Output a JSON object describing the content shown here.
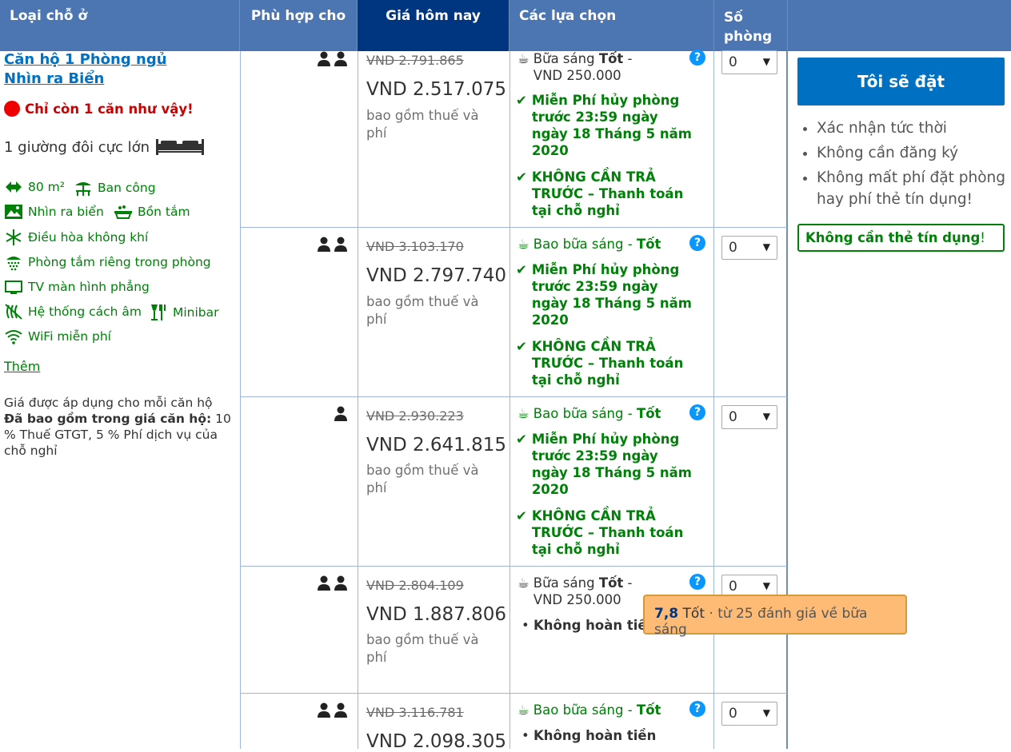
{
  "headers": {
    "room_type": "Loại chỗ ở",
    "sleeps": "Phù hợp cho",
    "price_today": "Giá hôm nay",
    "choices": "Các lựa chọn",
    "rooms_line1": "Số",
    "rooms_line2": "phòng"
  },
  "room": {
    "title_line1": "Căn hộ 1 Phòng ngủ",
    "title_line2": "Nhìn ra Biển",
    "scarcity": "Chỉ còn 1 căn như vậy!",
    "bed": "1 giường đôi cực lớn",
    "facilities": {
      "size": "80 m²",
      "balcony": "Ban công",
      "sea_view": "Nhìn ra biển",
      "bathtub": "Bồn tắm",
      "aircon": "Điều hòa không khí",
      "private_bath": "Phòng tắm riêng trong phòng",
      "flat_tv": "TV màn hình phẳng",
      "soundproof": "Hệ thống cách âm",
      "minibar": "Minibar",
      "wifi": "WiFi miễn phí"
    },
    "more_link": "Thêm",
    "price_note_line1": "Giá được áp dụng cho mỗi căn hộ",
    "price_note_bold": "Đã bao gồm trong giá căn hộ:",
    "price_note_rest": " 10 % Thuế GTGT, 5 % Phí dịch vụ của chỗ nghỉ"
  },
  "rows": [
    {
      "old_price": "VND 2.791.865",
      "price": "VND 2.517.075",
      "tax_note": "bao gồm thuế và phí",
      "breakfast_prefix": "Bữa sáng",
      "breakfast_rating": "Tốt",
      "breakfast_sep": " -",
      "breakfast_price": "VND 250.000",
      "cancel": "Miễn Phí hủy phòng trước 23:59 ngày ngày 18 Tháng 5 năm 2020",
      "prepay": "KHÔNG CẦN TRẢ TRƯỚC – Thanh toán tại chỗ nghỉ",
      "qty": "0"
    },
    {
      "old_price": "VND 3.103.170",
      "price": "VND 2.797.740",
      "tax_note": "bao gồm thuế và phí",
      "breakfast_prefix": "Bao bữa sáng",
      "breakfast_rating": "Tốt",
      "breakfast_sep": " - ",
      "cancel": "Miễn Phí hủy phòng trước 23:59 ngày ngày 18 Tháng 5 năm 2020",
      "prepay": "KHÔNG CẦN TRẢ TRƯỚC – Thanh toán tại chỗ nghỉ",
      "qty": "0"
    },
    {
      "old_price": "VND 2.930.223",
      "price": "VND 2.641.815",
      "tax_note": "bao gồm thuế và phí",
      "breakfast_prefix": "Bao bữa sáng",
      "breakfast_rating": "Tốt",
      "breakfast_sep": " - ",
      "cancel": "Miễn Phí hủy phòng trước 23:59 ngày ngày 18 Tháng 5 năm 2020",
      "prepay": "KHÔNG CẦN TRẢ TRƯỚC – Thanh toán tại chỗ nghỉ",
      "qty": "0"
    },
    {
      "old_price": "VND 2.804.109",
      "price": "VND 1.887.806",
      "tax_note": "bao gồm thuế và phí",
      "breakfast_prefix": "Bữa sáng",
      "breakfast_rating": "Tốt",
      "breakfast_sep": " -",
      "breakfast_price": "VND 250.000",
      "nonrefund": "Không hoàn tiền",
      "qty": "0"
    },
    {
      "old_price": "VND 3.116.781",
      "price": "VND 2.098.305",
      "breakfast_prefix": "Bao bữa sáng",
      "breakfast_rating": "Tốt",
      "breakfast_sep": " - ",
      "nonrefund": "Không hoàn tiền",
      "qty": "0"
    }
  ],
  "sidebar": {
    "reserve_button": "Tôi sẽ đặt",
    "benefits": [
      "Xác nhận tức thời",
      "Không cần đăng ký",
      "Không mất phí đặt phòng hay phí thẻ tín dụng!"
    ],
    "no_card_text": "Không cần thẻ tín dụng",
    "no_card_excl": "!"
  },
  "tooltip": {
    "score": "7,8",
    "rating": "Tốt",
    "text": " · từ 25 đánh giá về bữa sáng"
  },
  "colors": {
    "header_bg": "#4c76b2",
    "header_active": "#003580",
    "accent_blue": "#0071c2",
    "green": "#008009",
    "tooltip_bg": "#febb76",
    "scarcity_red": "#cc0000"
  },
  "icons": [
    "two-persons-icon",
    "one-person-icon",
    "coffee-cup-icon",
    "checkmark-icon",
    "question-icon",
    "bed-icon",
    "size-icon",
    "balcony-icon",
    "sea-view-icon",
    "bathtub-icon",
    "snowflake-icon",
    "shower-icon",
    "tv-icon",
    "soundproof-icon",
    "minibar-icon",
    "wifi-icon"
  ]
}
